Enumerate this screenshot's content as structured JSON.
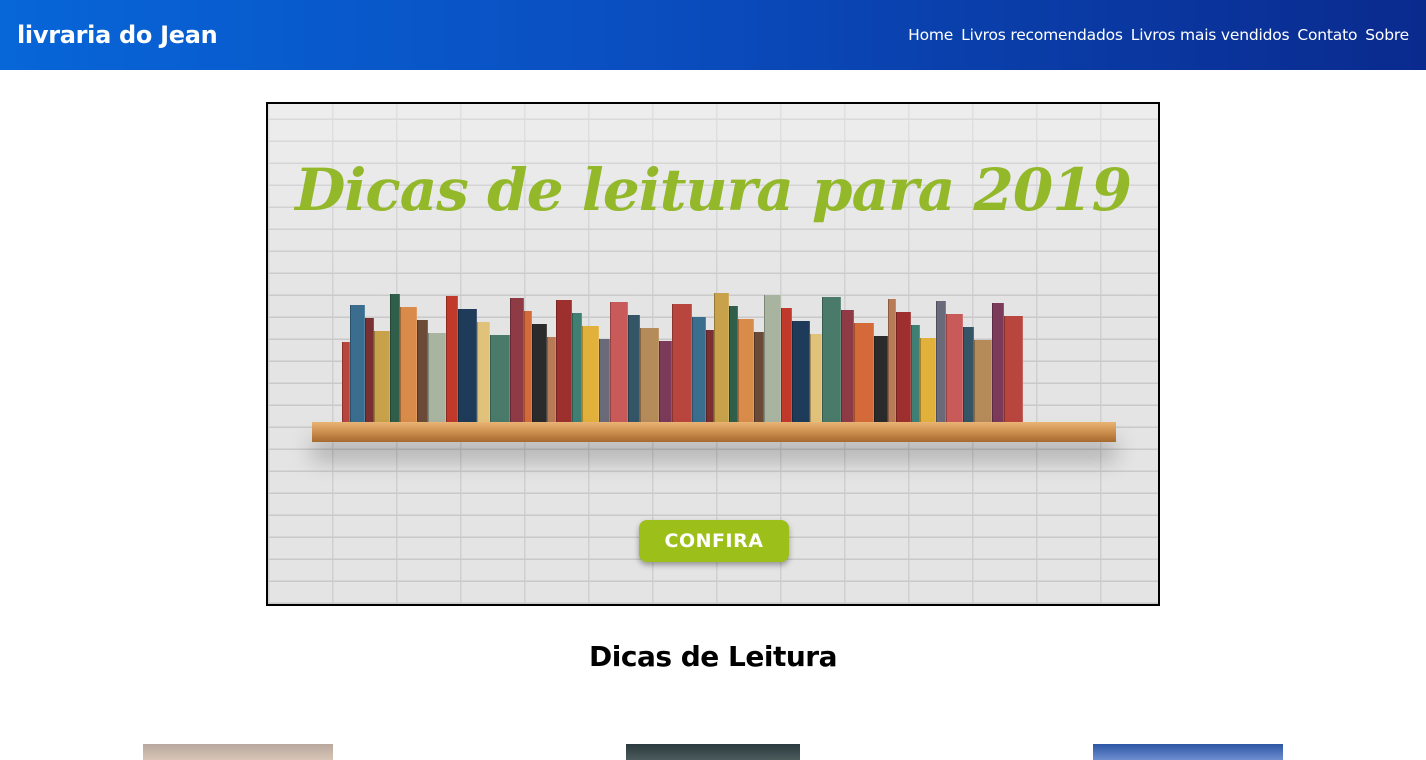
{
  "header": {
    "brand": "livraria do Jean",
    "nav": [
      "Home",
      "Livros recomendados",
      "Livros mais vendidos",
      "Contato",
      "Sobre"
    ]
  },
  "banner": {
    "title": "Dicas de leitura para 2019",
    "cta": "CONFIRA",
    "accent_color": "#9dbf1a"
  },
  "section": {
    "title": "Dicas de Leitura"
  }
}
